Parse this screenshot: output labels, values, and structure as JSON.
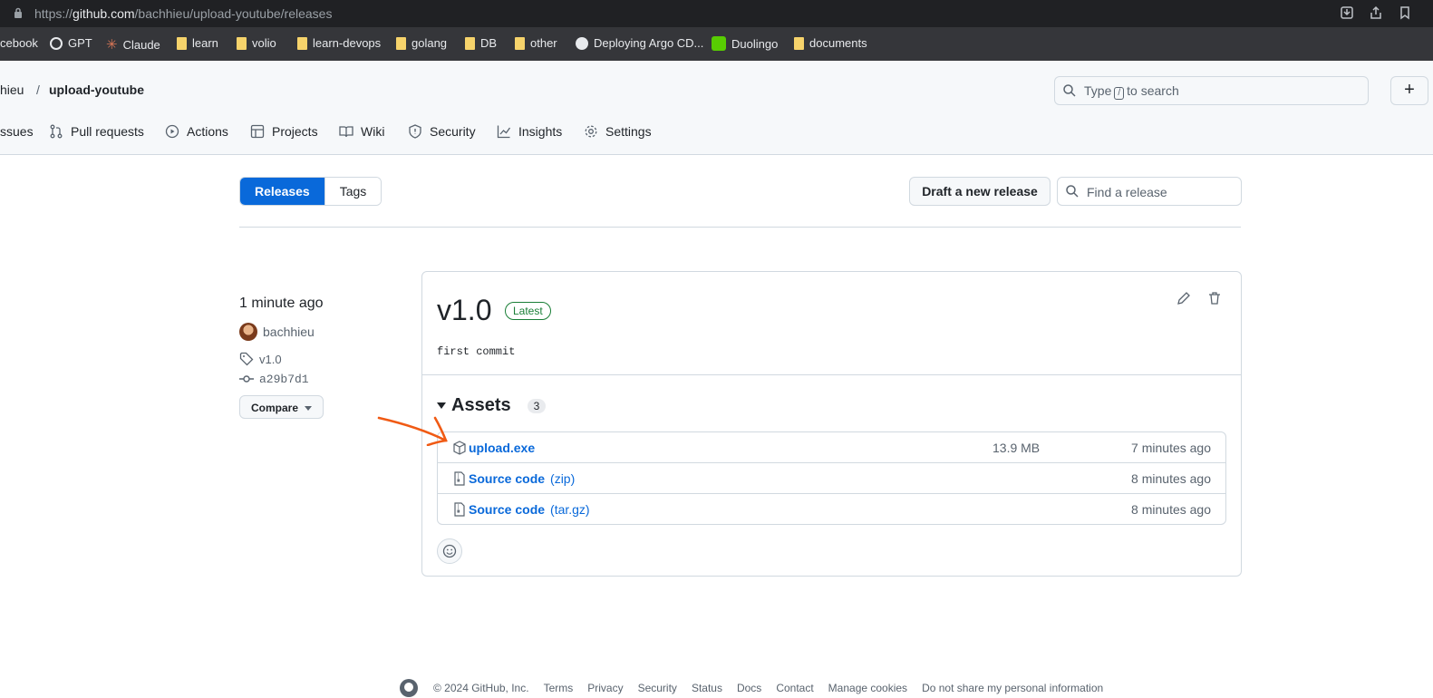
{
  "browser": {
    "url_prefix": "https://",
    "url_host": "github.com",
    "url_path": "/bachhieu/upload-youtube/releases",
    "bookmarks": [
      "cebook",
      "GPT",
      "Claude",
      "learn",
      "volio",
      "learn-devops",
      "golang",
      "DB",
      "other",
      "Deploying Argo CD...",
      "Duolingo",
      "documents"
    ]
  },
  "header": {
    "owner": "hieu",
    "separator": "/",
    "repo": "upload-youtube",
    "search_prefix": "Type",
    "search_key": "/",
    "search_suffix": "to search",
    "plus_label": "+"
  },
  "tabs": [
    "ssues",
    "Pull requests",
    "Actions",
    "Projects",
    "Wiki",
    "Security",
    "Insights",
    "Settings"
  ],
  "toolbar": {
    "releases_label": "Releases",
    "tags_label": "Tags",
    "draft_label": "Draft a new release",
    "find_placeholder": "Find a release"
  },
  "release": {
    "time_ago": "1 minute ago",
    "author": "bachhieu",
    "tag": "v1.0",
    "commit": "a29b7d1",
    "compare_label": "Compare",
    "title": "v1.0",
    "badge": "Latest",
    "body": "first commit",
    "assets_label": "Assets",
    "assets_count": "3",
    "assets": [
      {
        "name": "upload.exe",
        "ext": "",
        "size": "13.9 MB",
        "time": "7 minutes ago"
      },
      {
        "name": "Source code",
        "ext": "(zip)",
        "size": "",
        "time": "8 minutes ago"
      },
      {
        "name": "Source code",
        "ext": "(tar.gz)",
        "size": "",
        "time": "8 minutes ago"
      }
    ]
  },
  "footer": {
    "copyright": "© 2024 GitHub, Inc.",
    "links": [
      "Terms",
      "Privacy",
      "Security",
      "Status",
      "Docs",
      "Contact",
      "Manage cookies",
      "Do not share my personal information"
    ]
  },
  "colors": {
    "accent": "#0969da",
    "success": "#1a7f37",
    "annotation_arrow": "#f05a14"
  }
}
